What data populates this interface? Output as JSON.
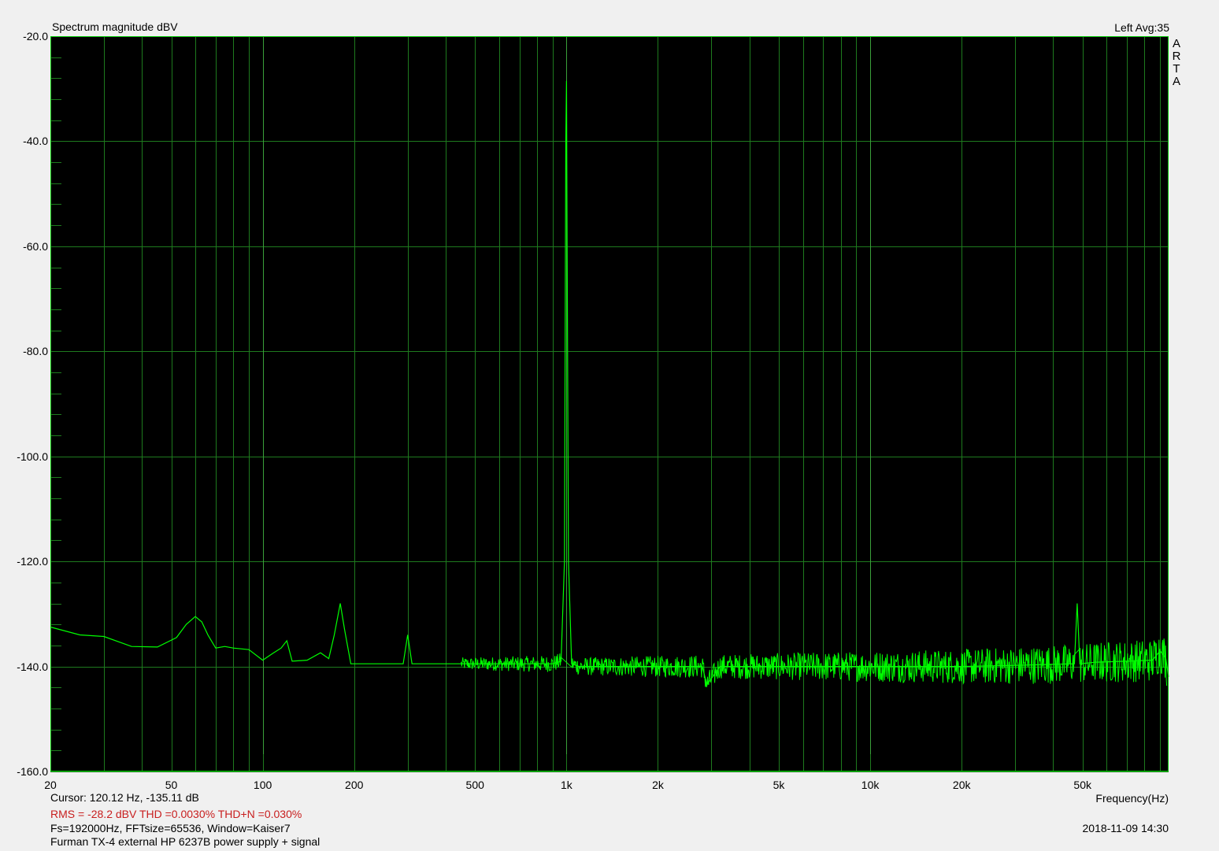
{
  "header": {
    "title": "Spectrum magnitude dBV",
    "channel_avg": "Left  Avg:35",
    "brand_letters": [
      "A",
      "R",
      "T",
      "A"
    ]
  },
  "footer": {
    "cursor": "Cursor: 120.12 Hz, -135.11 dB",
    "measurements": "RMS =  -28.2 dBV   THD =0.0030%   THD+N =0.030%",
    "settings": "Fs=192000Hz, FFTsize=65536, Window=Kaiser7",
    "description": "Furman TX-4 external HP 6237B  power supply + signal",
    "xaxis_label": "Frequency(Hz)",
    "datetime": "2018-11-09  14:30"
  },
  "colors": {
    "background": "#000000",
    "grid": "#1e7a1e",
    "trace": "#00ff00",
    "frame": "#00c800",
    "measure_text": "#c81e1e"
  },
  "chart_data": {
    "type": "line",
    "title": "Spectrum magnitude dBV",
    "xlabel": "Frequency(Hz)",
    "ylabel": "",
    "x_scale": "log",
    "xlim": [
      20,
      96000
    ],
    "ylim": [
      -160,
      -20
    ],
    "grid": true,
    "y_ticks": [
      -20,
      -40,
      -60,
      -80,
      -100,
      -120,
      -140,
      -160
    ],
    "y_tick_labels": [
      "-20.0",
      "-40.0",
      "-60.0",
      "-80.0",
      "-100.0",
      "-120.0",
      "-140.0",
      "-160.0"
    ],
    "x_ticks": [
      20,
      50,
      100,
      200,
      500,
      1000,
      2000,
      5000,
      10000,
      20000,
      50000
    ],
    "x_tick_labels": [
      "20",
      "50",
      "100",
      "200",
      "500",
      "1k",
      "2k",
      "5k",
      "10k",
      "20k",
      "50k"
    ],
    "series": [
      {
        "x": [
          20,
          25,
          30,
          37,
          45,
          52,
          56,
          60,
          63,
          66,
          70,
          75,
          80,
          90,
          100,
          108,
          115,
          120,
          125,
          140,
          155,
          165,
          172,
          180,
          186,
          195,
          210,
          230,
          250,
          270,
          290,
          300,
          310,
          330,
          360,
          400,
          450,
          480,
          500,
          550,
          600,
          700,
          800,
          900,
          960,
          985,
          995,
          1000,
          1005,
          1015,
          1040,
          1100,
          1300,
          1600,
          2000,
          2500,
          2800,
          2900,
          3200,
          4000,
          5000,
          7000,
          10000,
          15000,
          20000,
          30000,
          40000,
          47000,
          48000,
          49000,
          55000,
          70000,
          85000,
          90000,
          94000,
          96000
        ],
        "values": [
          -132.5,
          -134,
          -134.3,
          -136.2,
          -136.3,
          -134.5,
          -132,
          -130.5,
          -131.5,
          -134,
          -136.5,
          -136.2,
          -136.5,
          -136.8,
          -138.8,
          -137.5,
          -136.5,
          -135.1,
          -139,
          -138.8,
          -137.4,
          -138.5,
          -134,
          -128,
          -133,
          -139.5,
          -139.5,
          -139.5,
          -139.5,
          -139.5,
          -139.5,
          -134,
          -139.5,
          -139.5,
          -139.5,
          -139.5,
          -139.5,
          -139.5,
          -139.5,
          -139.5,
          -139.5,
          -139.5,
          -139.5,
          -139.5,
          -139,
          -120,
          -40,
          -28.5,
          -60,
          -120,
          -139.5,
          -140,
          -140,
          -140,
          -140,
          -140,
          -140,
          -143.5,
          -140,
          -140,
          -140,
          -140,
          -140,
          -140,
          -140,
          -139.8,
          -139.6,
          -139.5,
          -128,
          -139.5,
          -139.2,
          -139,
          -138.8,
          -137,
          -138.5,
          -142
        ]
      }
    ]
  }
}
